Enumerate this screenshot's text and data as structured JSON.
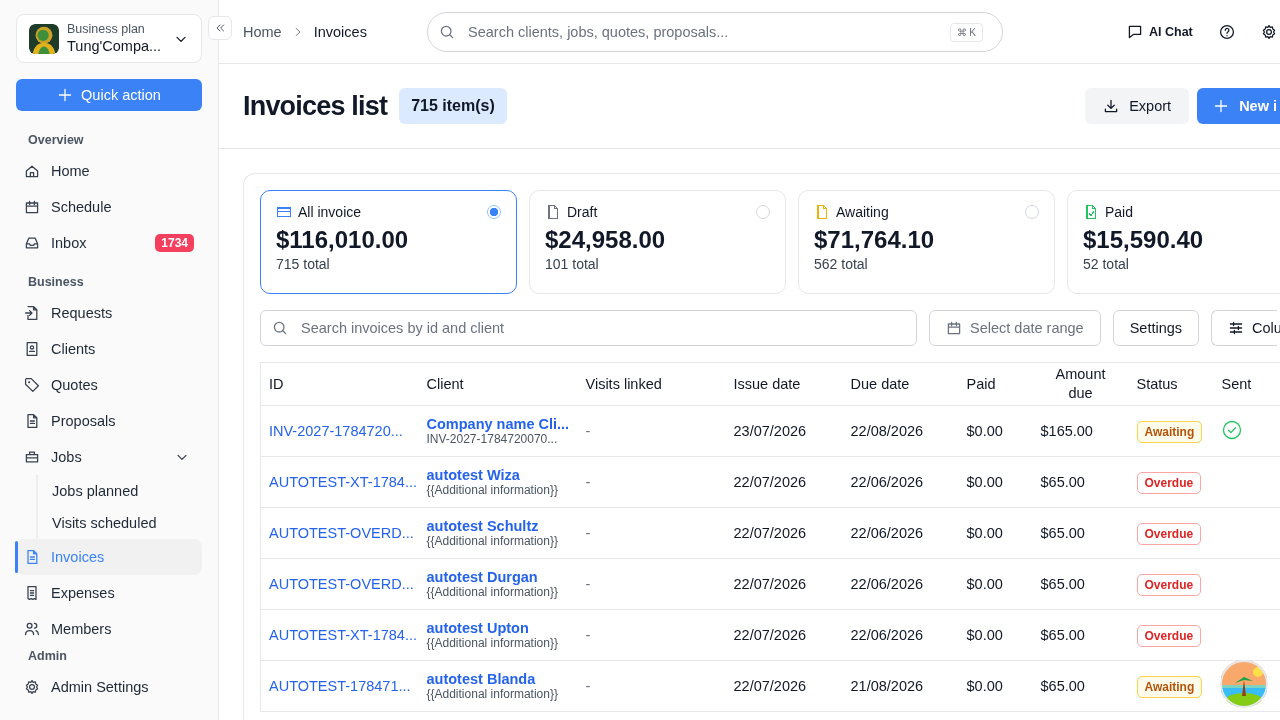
{
  "sidebar": {
    "workspace": {
      "plan": "Business plan",
      "name": "Tung'Compa..."
    },
    "quick_action": "Quick action",
    "sections": [
      {
        "title": "Overview",
        "items": [
          {
            "label": "Home",
            "selected": false
          },
          {
            "label": "Schedule",
            "selected": false
          },
          {
            "label": "Inbox",
            "selected": false,
            "badge": "1734"
          }
        ]
      },
      {
        "title": "Business",
        "items": [
          {
            "label": "Requests",
            "selected": false
          },
          {
            "label": "Clients",
            "selected": false
          },
          {
            "label": "Quotes",
            "selected": false
          },
          {
            "label": "Proposals",
            "selected": false
          },
          {
            "label": "Jobs",
            "selected": false,
            "expanded": true,
            "children": [
              {
                "label": "Jobs planned",
                "selected": false
              },
              {
                "label": "Visits scheduled",
                "selected": false
              }
            ]
          },
          {
            "label": "Invoices",
            "selected": true
          },
          {
            "label": "Expenses",
            "selected": false
          },
          {
            "label": "Members",
            "selected": false
          }
        ]
      },
      {
        "title": "Admin",
        "items": [
          {
            "label": "Admin Settings",
            "selected": false
          }
        ]
      }
    ]
  },
  "breadcrumb": [
    "Home",
    "Invoices"
  ],
  "search": {
    "placeholder": "Search clients, jobs, quotes, proposals...",
    "shortcut": "⌘ K"
  },
  "top_actions": {
    "ai_chat": "AI Chat"
  },
  "header": {
    "title": "Invoices list",
    "count": "715 item(s)",
    "export": "Export",
    "new": "New i"
  },
  "filter_cards": [
    {
      "label": "All invoice",
      "amount": "$116,010.00",
      "total": "715 total",
      "selected": true,
      "color": "#3b82f6"
    },
    {
      "label": "Draft",
      "amount": "$24,958.00",
      "total": "101 total",
      "selected": false,
      "color": "#6b7280"
    },
    {
      "label": "Awaiting",
      "amount": "$71,764.10",
      "total": "562 total",
      "selected": false,
      "color": "#eab308"
    },
    {
      "label": "Paid",
      "amount": "$15,590.40",
      "total": "52 total",
      "selected": false,
      "color": "#22c55e"
    }
  ],
  "toolbar": {
    "search_placeholder": "Search invoices by id and client",
    "date_placeholder": "Select date range",
    "settings": "Settings",
    "columns": "Colu"
  },
  "table": {
    "columns": [
      "ID",
      "Client",
      "Visits linked",
      "Issue date",
      "Due date",
      "Paid",
      "Amount due",
      "Status",
      "Sent"
    ],
    "rows": [
      {
        "id": "INV-2027-1784720...",
        "client": "Company name Cli...",
        "client_info": "INV-2027-1784720070...",
        "visits": "-",
        "issue": "23/07/2026",
        "due": "22/08/2026",
        "paid": "$0.00",
        "amount": "$165.00",
        "status": {
          "label": "Awaiting",
          "kind": "awaiting"
        },
        "sent": true
      },
      {
        "id": "AUTOTEST-XT-1784...",
        "client": "autotest Wiza",
        "client_info": "{{Additional information}}",
        "visits": "-",
        "issue": "22/07/2026",
        "due": "22/06/2026",
        "paid": "$0.00",
        "amount": "$65.00",
        "status": {
          "label": "Overdue",
          "kind": "overdue"
        },
        "sent": false
      },
      {
        "id": "AUTOTEST-OVERD...",
        "client": "autotest Schultz",
        "client_info": "{{Additional information}}",
        "visits": "-",
        "issue": "22/07/2026",
        "due": "22/06/2026",
        "paid": "$0.00",
        "amount": "$65.00",
        "status": {
          "label": "Overdue",
          "kind": "overdue"
        },
        "sent": false
      },
      {
        "id": "AUTOTEST-OVERD...",
        "client": "autotest Durgan",
        "client_info": "{{Additional information}}",
        "visits": "-",
        "issue": "22/07/2026",
        "due": "22/06/2026",
        "paid": "$0.00",
        "amount": "$65.00",
        "status": {
          "label": "Overdue",
          "kind": "overdue"
        },
        "sent": false
      },
      {
        "id": "AUTOTEST-XT-1784...",
        "client": "autotest Upton",
        "client_info": "{{Additional information}}",
        "visits": "-",
        "issue": "22/07/2026",
        "due": "22/06/2026",
        "paid": "$0.00",
        "amount": "$65.00",
        "status": {
          "label": "Overdue",
          "kind": "overdue"
        },
        "sent": false
      },
      {
        "id": "AUTOTEST-178471...",
        "client": "autotest Blanda",
        "client_info": "{{Additional information}}",
        "visits": "-",
        "issue": "22/07/2026",
        "due": "21/08/2026",
        "paid": "$0.00",
        "amount": "$65.00",
        "status": {
          "label": "Awaiting",
          "kind": "awaiting"
        },
        "sent": false
      }
    ]
  }
}
